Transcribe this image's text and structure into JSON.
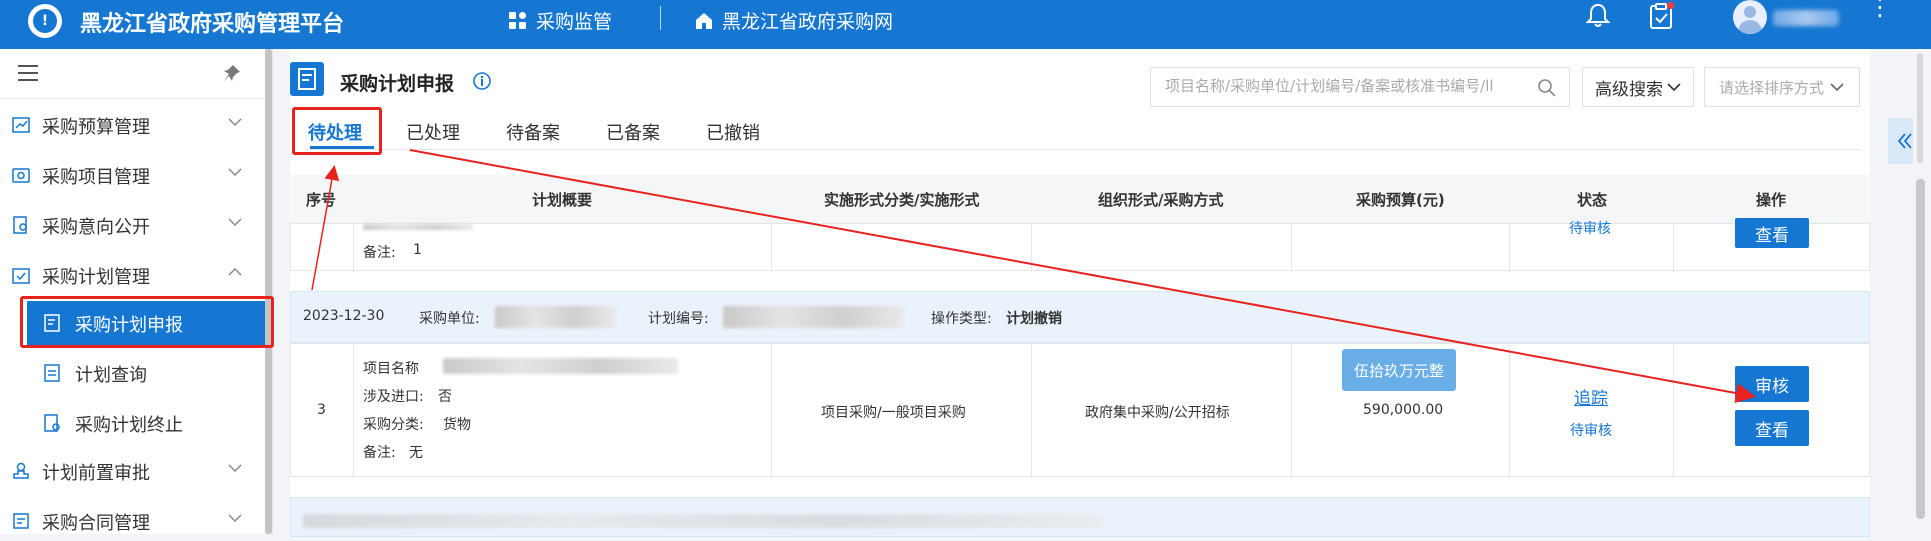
{
  "header": {
    "app_title": "黑龙江省政府采购管理平台",
    "nav_monitor": "采购监管",
    "nav_portal": "黑龙江省政府采购网",
    "more": "⋮"
  },
  "sidebar": {
    "items": [
      {
        "label": "采购预算管理"
      },
      {
        "label": "采购项目管理"
      },
      {
        "label": "采购意向公开"
      },
      {
        "label": "采购计划管理"
      },
      {
        "label": "采购计划申报"
      },
      {
        "label": "计划查询"
      },
      {
        "label": "采购计划终止"
      },
      {
        "label": "计划前置审批"
      },
      {
        "label": "采购合同管理"
      }
    ]
  },
  "page": {
    "title": "采购计划申报",
    "search_placeholder": "项目名称/采购单位/计划编号/备案或核准书编号/ll",
    "advanced_search": "高级搜索",
    "sort_placeholder": "请选择排序方式",
    "tabs": [
      "待处理",
      "已处理",
      "待备案",
      "已备案",
      "已撤销"
    ]
  },
  "table": {
    "headers": [
      "序号",
      "计划概要",
      "实施形式分类/实施形式",
      "组织形式/采购方式",
      "采购预算(元)",
      "状态",
      "操作"
    ],
    "prev_row": {
      "remark_label": "备注:",
      "remark_value": "1",
      "status": "待审核",
      "view_btn": "查看"
    },
    "group": {
      "date": "2023-12-30",
      "unit_label": "采购单位:",
      "plan_no_label": "计划编号:",
      "op_type_label": "操作类型:",
      "op_type_value": "计划撤销"
    },
    "row": {
      "index": "3",
      "project_name_label": "项目名称",
      "import_label": "涉及进口:",
      "import_value": "否",
      "category_label": "采购分类:",
      "category_value": "货物",
      "remark_label": "备注:",
      "remark_value": "无",
      "impl_form": "项目采购/一般项目采购",
      "org_form": "政府集中采购/公开招标",
      "budget": "590,000.00",
      "budget_tooltip": "伍拾玖万元整",
      "track_link": "追踪",
      "status": "待审核",
      "review_btn": "审核",
      "view_btn": "查看"
    }
  },
  "colors": {
    "brand": "#1677d2",
    "annotation": "#e8221e"
  }
}
